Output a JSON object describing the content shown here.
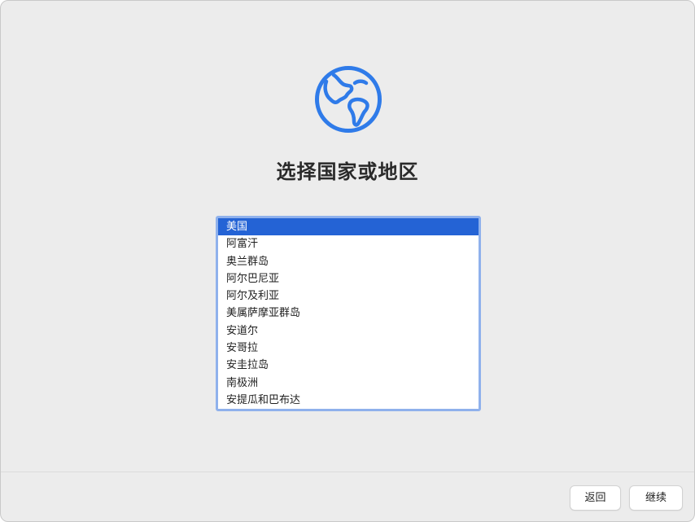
{
  "title": "选择国家或地区",
  "icons": {
    "globe": "globe-icon"
  },
  "colors": {
    "accent": "#2F7BE9",
    "selection": "#2463D5",
    "list_focus_border": "#8FB1EC"
  },
  "country_list": {
    "selected_index": 0,
    "items": [
      "美国",
      "阿富汗",
      "奥兰群岛",
      "阿尔巴尼亚",
      "阿尔及利亚",
      "美属萨摩亚群岛",
      "安道尔",
      "安哥拉",
      "安圭拉岛",
      "南极洲",
      "安提瓜和巴布达"
    ]
  },
  "buttons": {
    "back": "返回",
    "continue": "继续"
  }
}
